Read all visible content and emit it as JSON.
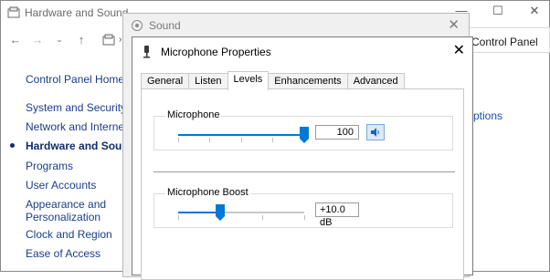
{
  "control_panel": {
    "title": "Hardware and Sound",
    "address_tail": "Control Panel",
    "sidebar": {
      "home": "Control Panel Home",
      "items": [
        {
          "label": "System and Security"
        },
        {
          "label": "Network and Internet"
        },
        {
          "label": "Hardware and Sound",
          "active": true
        },
        {
          "label": "Programs"
        },
        {
          "label": "User Accounts"
        },
        {
          "label": "Appearance and\nPersonalization"
        },
        {
          "label": "Clock and Region"
        },
        {
          "label": "Ease of Access"
        }
      ]
    },
    "right_link": "ptions"
  },
  "sound_window": {
    "title": "Sound"
  },
  "mic_properties": {
    "title": "Microphone Properties",
    "tabs": [
      "General",
      "Listen",
      "Levels",
      "Enhancements",
      "Advanced"
    ],
    "active_tab": "Levels",
    "microphone": {
      "label": "Microphone",
      "value": "100",
      "level": 1.0
    },
    "boost": {
      "label": "Microphone Boost",
      "value": "+10.0 dB",
      "level": 0.3333
    }
  }
}
